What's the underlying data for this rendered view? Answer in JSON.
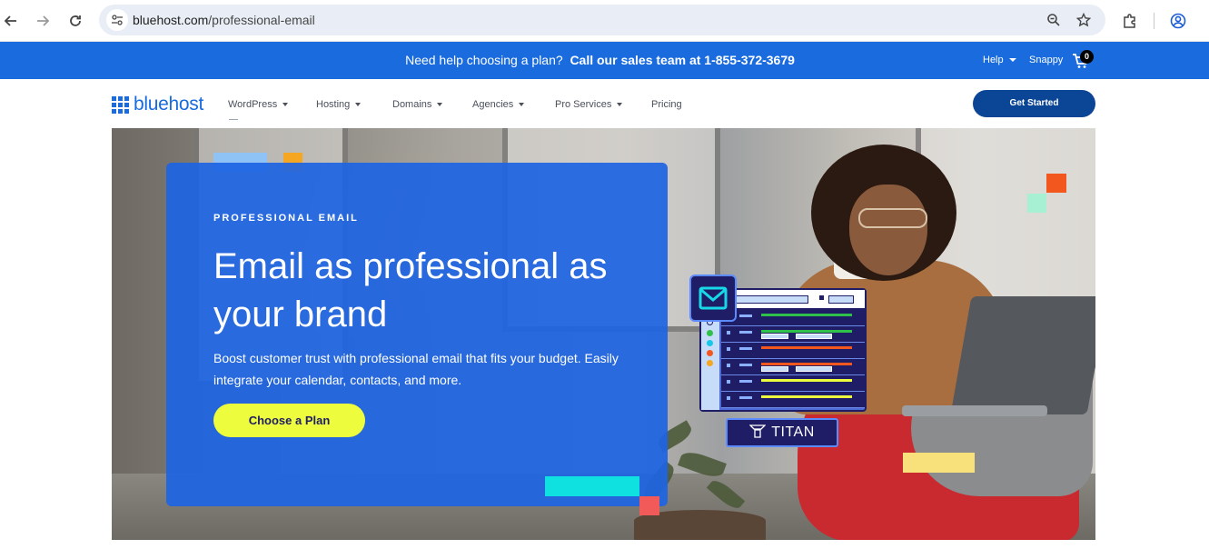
{
  "browser": {
    "url_host": "bluehost.com",
    "url_path": "/professional-email",
    "icons": [
      "back-arrow-icon",
      "forward-arrow-icon",
      "reload-icon",
      "site-info-icon",
      "zoom-icon",
      "bookmark-star-icon",
      "extensions-icon",
      "profile-icon"
    ]
  },
  "helpbar": {
    "prefix": "Need help choosing a plan?",
    "sales": "Call our sales team at 1-855-372-3679",
    "help": "Help",
    "snappy": "Snappy",
    "cart_count": "0"
  },
  "nav": {
    "logo": "bluehost",
    "items": [
      {
        "label": "WordPress",
        "dropdown": true
      },
      {
        "label": "Hosting",
        "dropdown": true
      },
      {
        "label": "Domains",
        "dropdown": true
      },
      {
        "label": "Agencies",
        "dropdown": true
      },
      {
        "label": "Pro Services",
        "dropdown": true
      },
      {
        "label": "Pricing",
        "dropdown": false
      }
    ],
    "cta": "Get Started"
  },
  "hero": {
    "eyebrow": "PROFESSIONAL EMAIL",
    "headline": "Email as professional as your brand",
    "subtext": "Boost customer trust with professional email that fits your budget. Easily integrate your calendar, contacts, and more.",
    "button": "Choose a Plan",
    "titan_label": "TITAN"
  },
  "colors": {
    "brand_blue": "#196bde",
    "cta_navy": "#0b4595",
    "button_yellow": "#eefc3e",
    "deco_orange": "#f5a623",
    "deco_cyan": "#0fe0e0",
    "deco_red": "#f25a5a"
  }
}
